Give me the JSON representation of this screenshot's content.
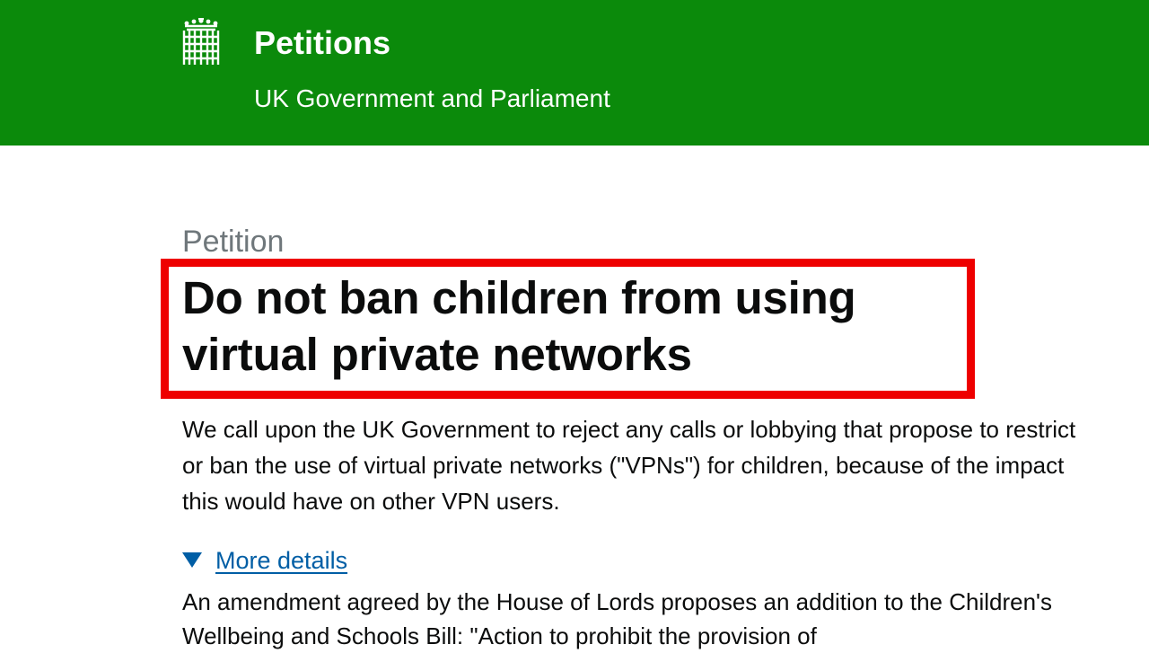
{
  "header": {
    "logo_icon": "portcullis-icon",
    "site_title": "Petitions",
    "site_subtitle": "UK Government and Parliament",
    "background_color": "#0b8a0b"
  },
  "petition": {
    "caption": "Petition",
    "title": "Do not ban children from using virtual private networks",
    "summary": "We call upon the UK Government to reject any calls or lobbying that propose to restrict or ban the use of virtual private networks (\"VPNs\") for children, because of the impact this would have on other VPN users.",
    "highlight_color": "#ee0000"
  },
  "details": {
    "toggle_icon": "triangle-down-icon",
    "toggle_label": "More details",
    "text": "An amendment agreed by the House of Lords proposes an addition to the Children's Wellbeing and Schools Bill: \"Action to prohibit the provision of"
  }
}
